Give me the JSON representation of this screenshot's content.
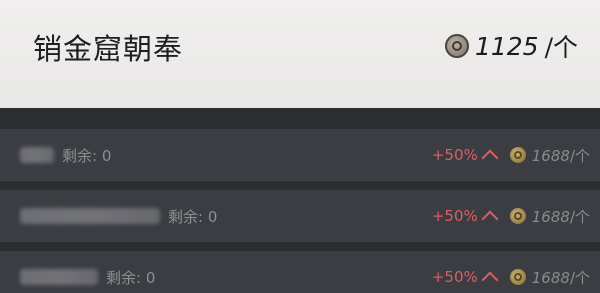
{
  "header": {
    "title": "销金窟朝奉",
    "price_value": "1125",
    "price_unit": "/个"
  },
  "rows": [
    {
      "name": "",
      "remain_label": "剩余: 0",
      "increase": "+50%",
      "price_value": "1688",
      "price_unit": "/个"
    },
    {
      "name": "",
      "remain_label": "剩余: 0",
      "increase": "+50%",
      "price_value": "1688",
      "price_unit": "/个"
    },
    {
      "name": "",
      "remain_label": "剩余: 0",
      "increase": "+50%",
      "price_value": "1688",
      "price_unit": "/个"
    }
  ],
  "colors": {
    "increase_red": "#d86063",
    "row_bg": "#3b3d42",
    "header_bg": "#ecebea",
    "coin_gold": "#9a8346"
  },
  "icons": {
    "header_coin": "coin-icon",
    "row_coin": "coin-icon",
    "increase": "arrow-up-icon"
  }
}
